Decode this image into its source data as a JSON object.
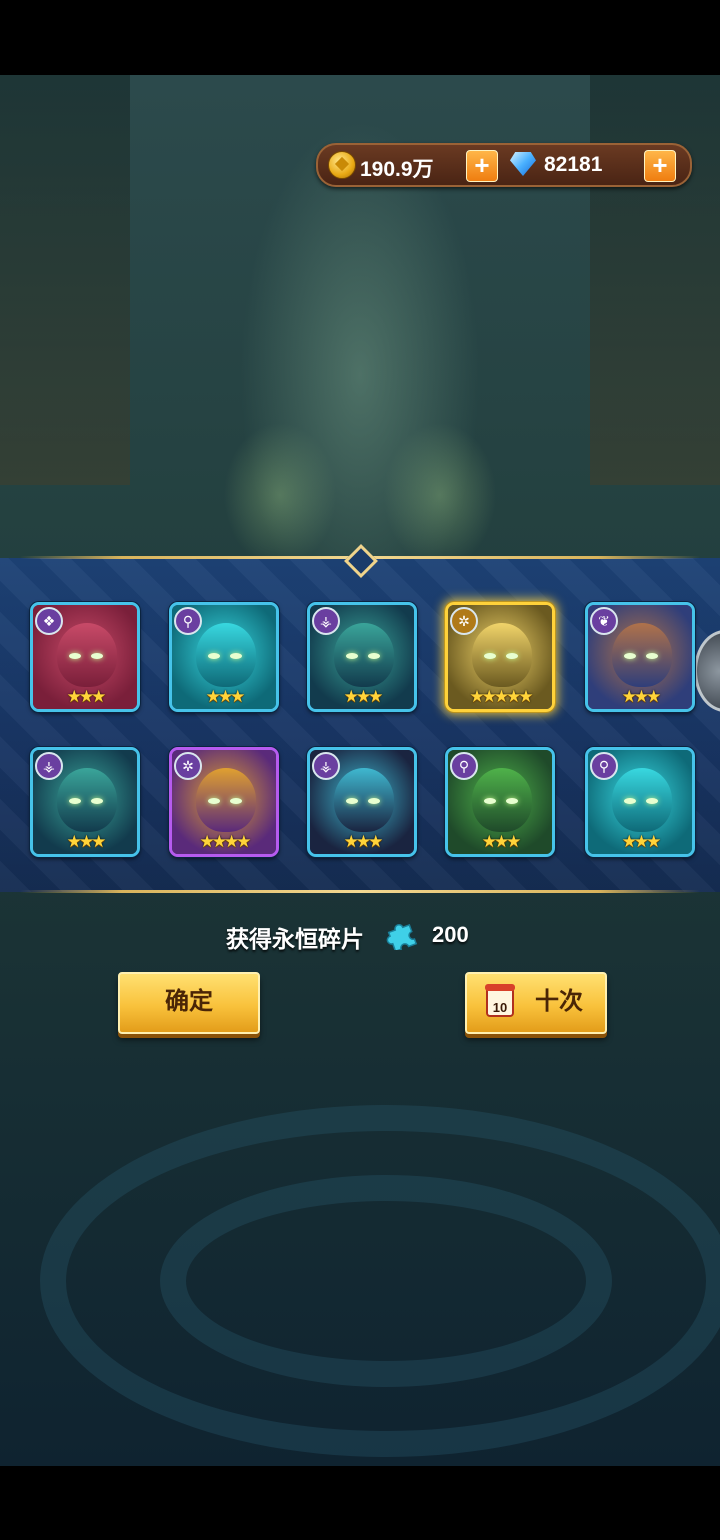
{
  "currency": {
    "gold": "190.9万",
    "gems": "82181",
    "gold_icon": "gold-coin-icon",
    "gem_icon": "diamond-icon",
    "plus_icon": "plus-icon"
  },
  "heroes": [
    {
      "stars": "★★★",
      "star_count": 3,
      "faction": "❖",
      "frame": "blue",
      "colors": [
        "#7a1f3a",
        "#c84a68"
      ]
    },
    {
      "stars": "★★★",
      "star_count": 3,
      "faction": "⚲",
      "frame": "blue",
      "colors": [
        "#0e6a78",
        "#38d8e0"
      ]
    },
    {
      "stars": "★★★",
      "star_count": 3,
      "faction": "⚶",
      "frame": "blue",
      "colors": [
        "#123b4d",
        "#3aa59a"
      ]
    },
    {
      "stars": "★★★★★",
      "star_count": 5,
      "faction": "✲",
      "frame": "gold",
      "colors": [
        "#6b5a20",
        "#f1d46a"
      ]
    },
    {
      "stars": "★★★",
      "star_count": 3,
      "faction": "❦",
      "frame": "blue",
      "colors": [
        "#2f3e7a",
        "#b0724a"
      ]
    },
    {
      "stars": "★★★",
      "star_count": 3,
      "faction": "⚶",
      "frame": "blue",
      "colors": [
        "#123b4d",
        "#3aa59a"
      ]
    },
    {
      "stars": "★★★★",
      "star_count": 4,
      "faction": "✲",
      "frame": "purple",
      "colors": [
        "#5a2a7a",
        "#e0a030"
      ]
    },
    {
      "stars": "★★★",
      "star_count": 3,
      "faction": "⚶",
      "frame": "blue",
      "colors": [
        "#1a2440",
        "#3fb8d0"
      ]
    },
    {
      "stars": "★★★",
      "star_count": 3,
      "faction": "⚲",
      "frame": "blue",
      "colors": [
        "#1f4a2a",
        "#4fb24a"
      ]
    },
    {
      "stars": "★★★",
      "star_count": 3,
      "faction": "⚲",
      "frame": "blue",
      "colors": [
        "#0e6a78",
        "#38d8e0"
      ]
    }
  ],
  "reward": {
    "label": "获得永恒碎片",
    "amount": "200",
    "icon": "puzzle-shard-icon"
  },
  "buttons": {
    "confirm": "确定",
    "ten_times": "十次",
    "ticket_number": "10"
  }
}
